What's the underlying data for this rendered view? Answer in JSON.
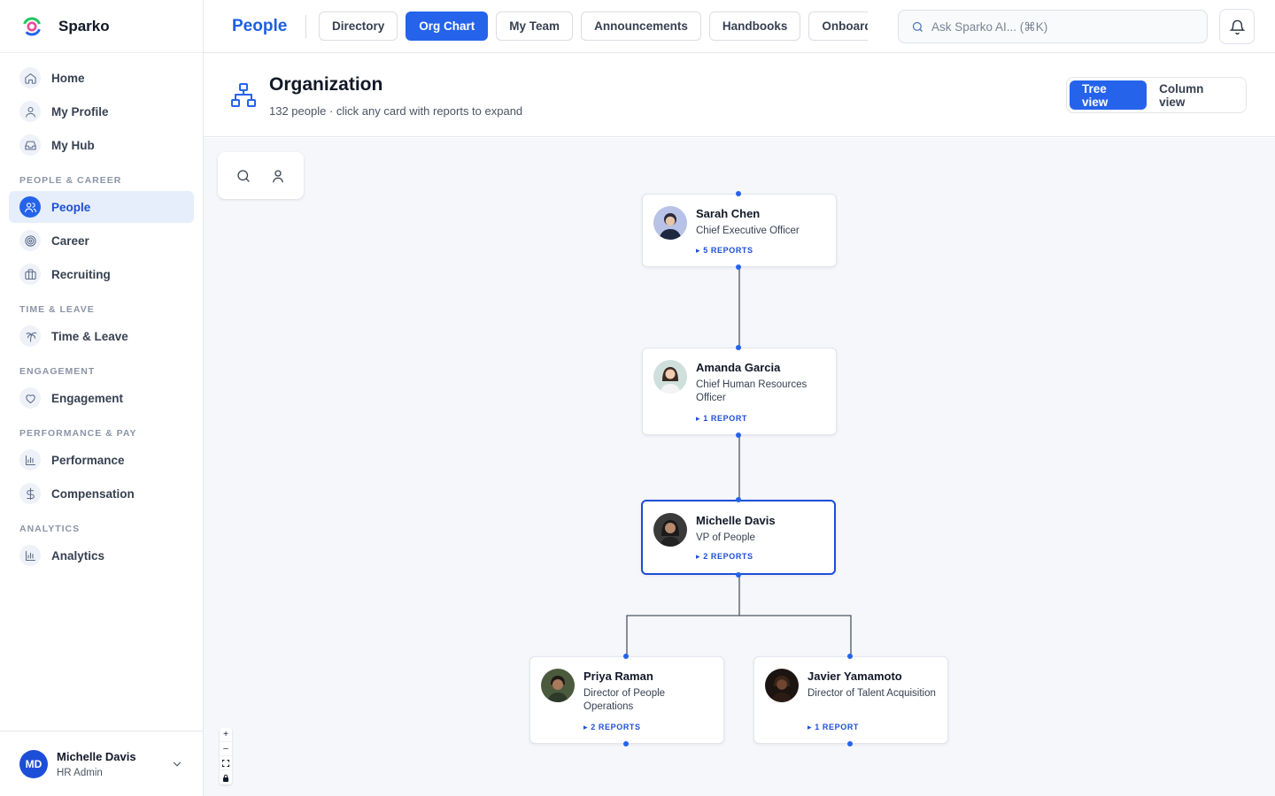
{
  "app": {
    "name": "Sparko"
  },
  "sidebar": {
    "items_top": [
      {
        "label": "Home",
        "icon": "home-icon"
      },
      {
        "label": "My Profile",
        "icon": "user-icon"
      },
      {
        "label": "My Hub",
        "icon": "inbox-icon"
      }
    ],
    "sections": [
      {
        "title": "PEOPLE & CAREER",
        "items": [
          {
            "label": "People",
            "icon": "users-icon",
            "active": true
          },
          {
            "label": "Career",
            "icon": "target-icon"
          },
          {
            "label": "Recruiting",
            "icon": "briefcase-icon"
          }
        ]
      },
      {
        "title": "TIME & LEAVE",
        "items": [
          {
            "label": "Time & Leave",
            "icon": "palm-tree-icon"
          }
        ]
      },
      {
        "title": "ENGAGEMENT",
        "items": [
          {
            "label": "Engagement",
            "icon": "heart-icon"
          }
        ]
      },
      {
        "title": "PERFORMANCE & PAY",
        "items": [
          {
            "label": "Performance",
            "icon": "bar-chart-icon"
          },
          {
            "label": "Compensation",
            "icon": "dollar-icon"
          }
        ]
      },
      {
        "title": "ANALYTICS",
        "items": [
          {
            "label": "Analytics",
            "icon": "bar-chart-icon"
          }
        ]
      }
    ],
    "user": {
      "initials": "MD",
      "name": "Michelle Davis",
      "role": "HR Admin"
    }
  },
  "topbar": {
    "section": "People",
    "tabs": [
      {
        "label": "Directory"
      },
      {
        "label": "Org Chart",
        "active": true
      },
      {
        "label": "My Team"
      },
      {
        "label": "Announcements"
      },
      {
        "label": "Handbooks"
      },
      {
        "label": "Onboarding"
      }
    ],
    "search_placeholder": "Ask Sparko AI... (⌘K)"
  },
  "page": {
    "title": "Organization",
    "subtitle": "132 people · click any card with reports to expand",
    "views": {
      "tree": "Tree view",
      "column": "Column view",
      "active": "tree"
    }
  },
  "zoom": {
    "in": "+",
    "out": "–",
    "fit": "⛶",
    "lock": "🔒"
  },
  "org": {
    "nodes": [
      {
        "id": "sarah",
        "name": "Sarah Chen",
        "title": "Chief Executive Officer",
        "reports": "▸ 5 REPORTS"
      },
      {
        "id": "amanda",
        "name": "Amanda Garcia",
        "title": "Chief Human Resources Officer",
        "reports": "▸ 1 REPORT"
      },
      {
        "id": "michelle",
        "name": "Michelle Davis",
        "title": "VP of People",
        "reports": "▸ 2 REPORTS",
        "selected": true
      },
      {
        "id": "priya",
        "name": "Priya Raman",
        "title": "Director of People Operations",
        "reports": "▸ 2 REPORTS"
      },
      {
        "id": "javier",
        "name": "Javier Yamamoto",
        "title": "Director of Talent Acquisition",
        "reports": "▸ 1 REPORT"
      }
    ]
  },
  "colors": {
    "accent": "#2563eb",
    "accent_dark": "#1d4ed8",
    "canvas_bg": "#f5f7fb",
    "edge": "#4b5563"
  }
}
